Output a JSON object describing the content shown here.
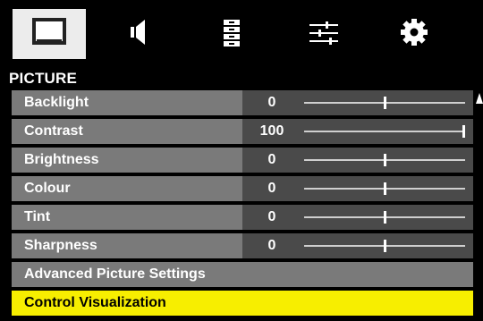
{
  "tabs": [
    {
      "icon": "picture-icon",
      "selected": true
    },
    {
      "icon": "speaker-icon",
      "selected": false
    },
    {
      "icon": "channel-list-icon",
      "selected": false
    },
    {
      "icon": "sliders-icon",
      "selected": false
    },
    {
      "icon": "gear-icon",
      "selected": false
    }
  ],
  "menu": {
    "title": "PICTURE",
    "items": [
      {
        "label": "Backlight",
        "value": "0",
        "level": 0.5
      },
      {
        "label": "Contrast",
        "value": "100",
        "level": 1.0
      },
      {
        "label": "Brightness",
        "value": "0",
        "level": 0.5
      },
      {
        "label": "Colour",
        "value": "0",
        "level": 0.5
      },
      {
        "label": "Tint",
        "value": "0",
        "level": 0.5
      },
      {
        "label": "Sharpness",
        "value": "0",
        "level": 0.5
      }
    ],
    "advanced_label": "Advanced Picture Settings",
    "control_label": "Control Visualization"
  },
  "colors": {
    "label_bg": "#7a7a7a",
    "value_bg": "#4a4a4a",
    "highlight": "#f7ee00",
    "selected_tab": "#ececec"
  }
}
